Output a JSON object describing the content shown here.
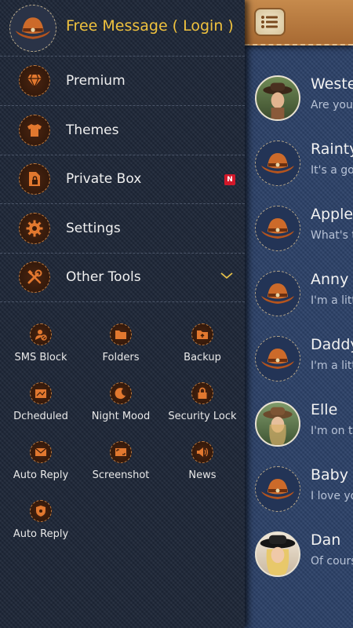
{
  "colors": {
    "accent": "#f0c23e",
    "icon_orange": "#e2782f",
    "badge_red": "#d3182a"
  },
  "header": {
    "title": "Free Message ( Login )",
    "avatar_icon": "cowboy-hat-icon"
  },
  "menu": [
    {
      "label": "Premium",
      "icon": "diamond-icon"
    },
    {
      "label": "Themes",
      "icon": "tshirt-icon"
    },
    {
      "label": "Private Box",
      "icon": "lock-file-icon",
      "badge": "N"
    },
    {
      "label": "Settings",
      "icon": "gear-icon"
    },
    {
      "label": "Other Tools",
      "icon": "tools-icon"
    }
  ],
  "tools": [
    {
      "label": "SMS Block",
      "icon": "person-block-icon"
    },
    {
      "label": "Folders",
      "icon": "folder-icon"
    },
    {
      "label": "Backup",
      "icon": "backup-folder-icon"
    },
    {
      "label": "Dcheduled",
      "icon": "scheduled-message-icon"
    },
    {
      "label": "Night Mood",
      "icon": "moon-icon"
    },
    {
      "label": "Security Lock",
      "icon": "padlock-icon"
    },
    {
      "label": "Auto Reply",
      "icon": "auto-reply-mail-icon"
    },
    {
      "label": "Screenshot",
      "icon": "screenshot-icon"
    },
    {
      "label": "News",
      "icon": "speaker-icon"
    },
    {
      "label": "Auto Reply",
      "icon": "auto-reply-shield-icon"
    }
  ],
  "conversations": [
    {
      "name": "Wester",
      "message": "Are you r",
      "avatar": "cowgirl-photo"
    },
    {
      "name": "Rainty",
      "message": "It's a goo",
      "avatar": "cowboy-hat-icon"
    },
    {
      "name": "Apple",
      "message": "What's th",
      "avatar": "cowboy-hat-icon"
    },
    {
      "name": "Anny",
      "message": "I'm a little",
      "avatar": "cowboy-hat-icon"
    },
    {
      "name": "Daddy",
      "message": "I'm a little",
      "avatar": "cowboy-hat-icon"
    },
    {
      "name": "Elle",
      "message": "I'm on th",
      "avatar": "cowgirl-photo"
    },
    {
      "name": "Baby",
      "message": "I love you",
      "avatar": "cowboy-hat-icon"
    },
    {
      "name": "Dan",
      "message": "Of cours",
      "avatar": "blonde-woman-photo"
    }
  ]
}
